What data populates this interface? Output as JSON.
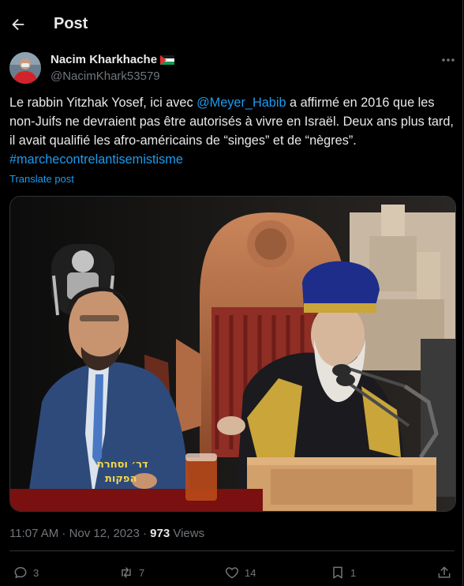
{
  "header": {
    "title": "Post"
  },
  "author": {
    "name": "Nacim Kharkhache",
    "handle": "@NacimKhark53579"
  },
  "tweet": {
    "t1": "Le rabbin Yitzhak Yosef, ici avec ",
    "mention": "@Meyer_Habib",
    "t2": " a affirmé en 2016 que les non-Juifs ne devraient pas être autorisés à vivre en Israël. Deux ans plus tard, il avait qualifié les afro-américains de “singes” et de “nègres”.",
    "hashtag": "#marchecontrelantisemistisme",
    "translate": "Translate post"
  },
  "media": {
    "caption_line1": "דר׳ וסחרת",
    "caption_line2": "הפקות"
  },
  "meta": {
    "time": "11:07 AM · Nov 12, 2023 · ",
    "views_count": "973",
    "views_label": " Views"
  },
  "actions": {
    "replies": "3",
    "reposts": "7",
    "likes": "14",
    "bookmarks": "1"
  },
  "icons": {
    "back": "arrow-left-icon",
    "more": "more-icon",
    "reply": "reply-icon",
    "repost": "repost-icon",
    "like": "heart-icon",
    "bookmark": "bookmark-icon",
    "share": "share-icon"
  },
  "colors": {
    "background": "#000000",
    "text": "#e7e9ea",
    "muted": "#71767b",
    "accent": "#1d9bf0",
    "border": "#2f3336"
  }
}
